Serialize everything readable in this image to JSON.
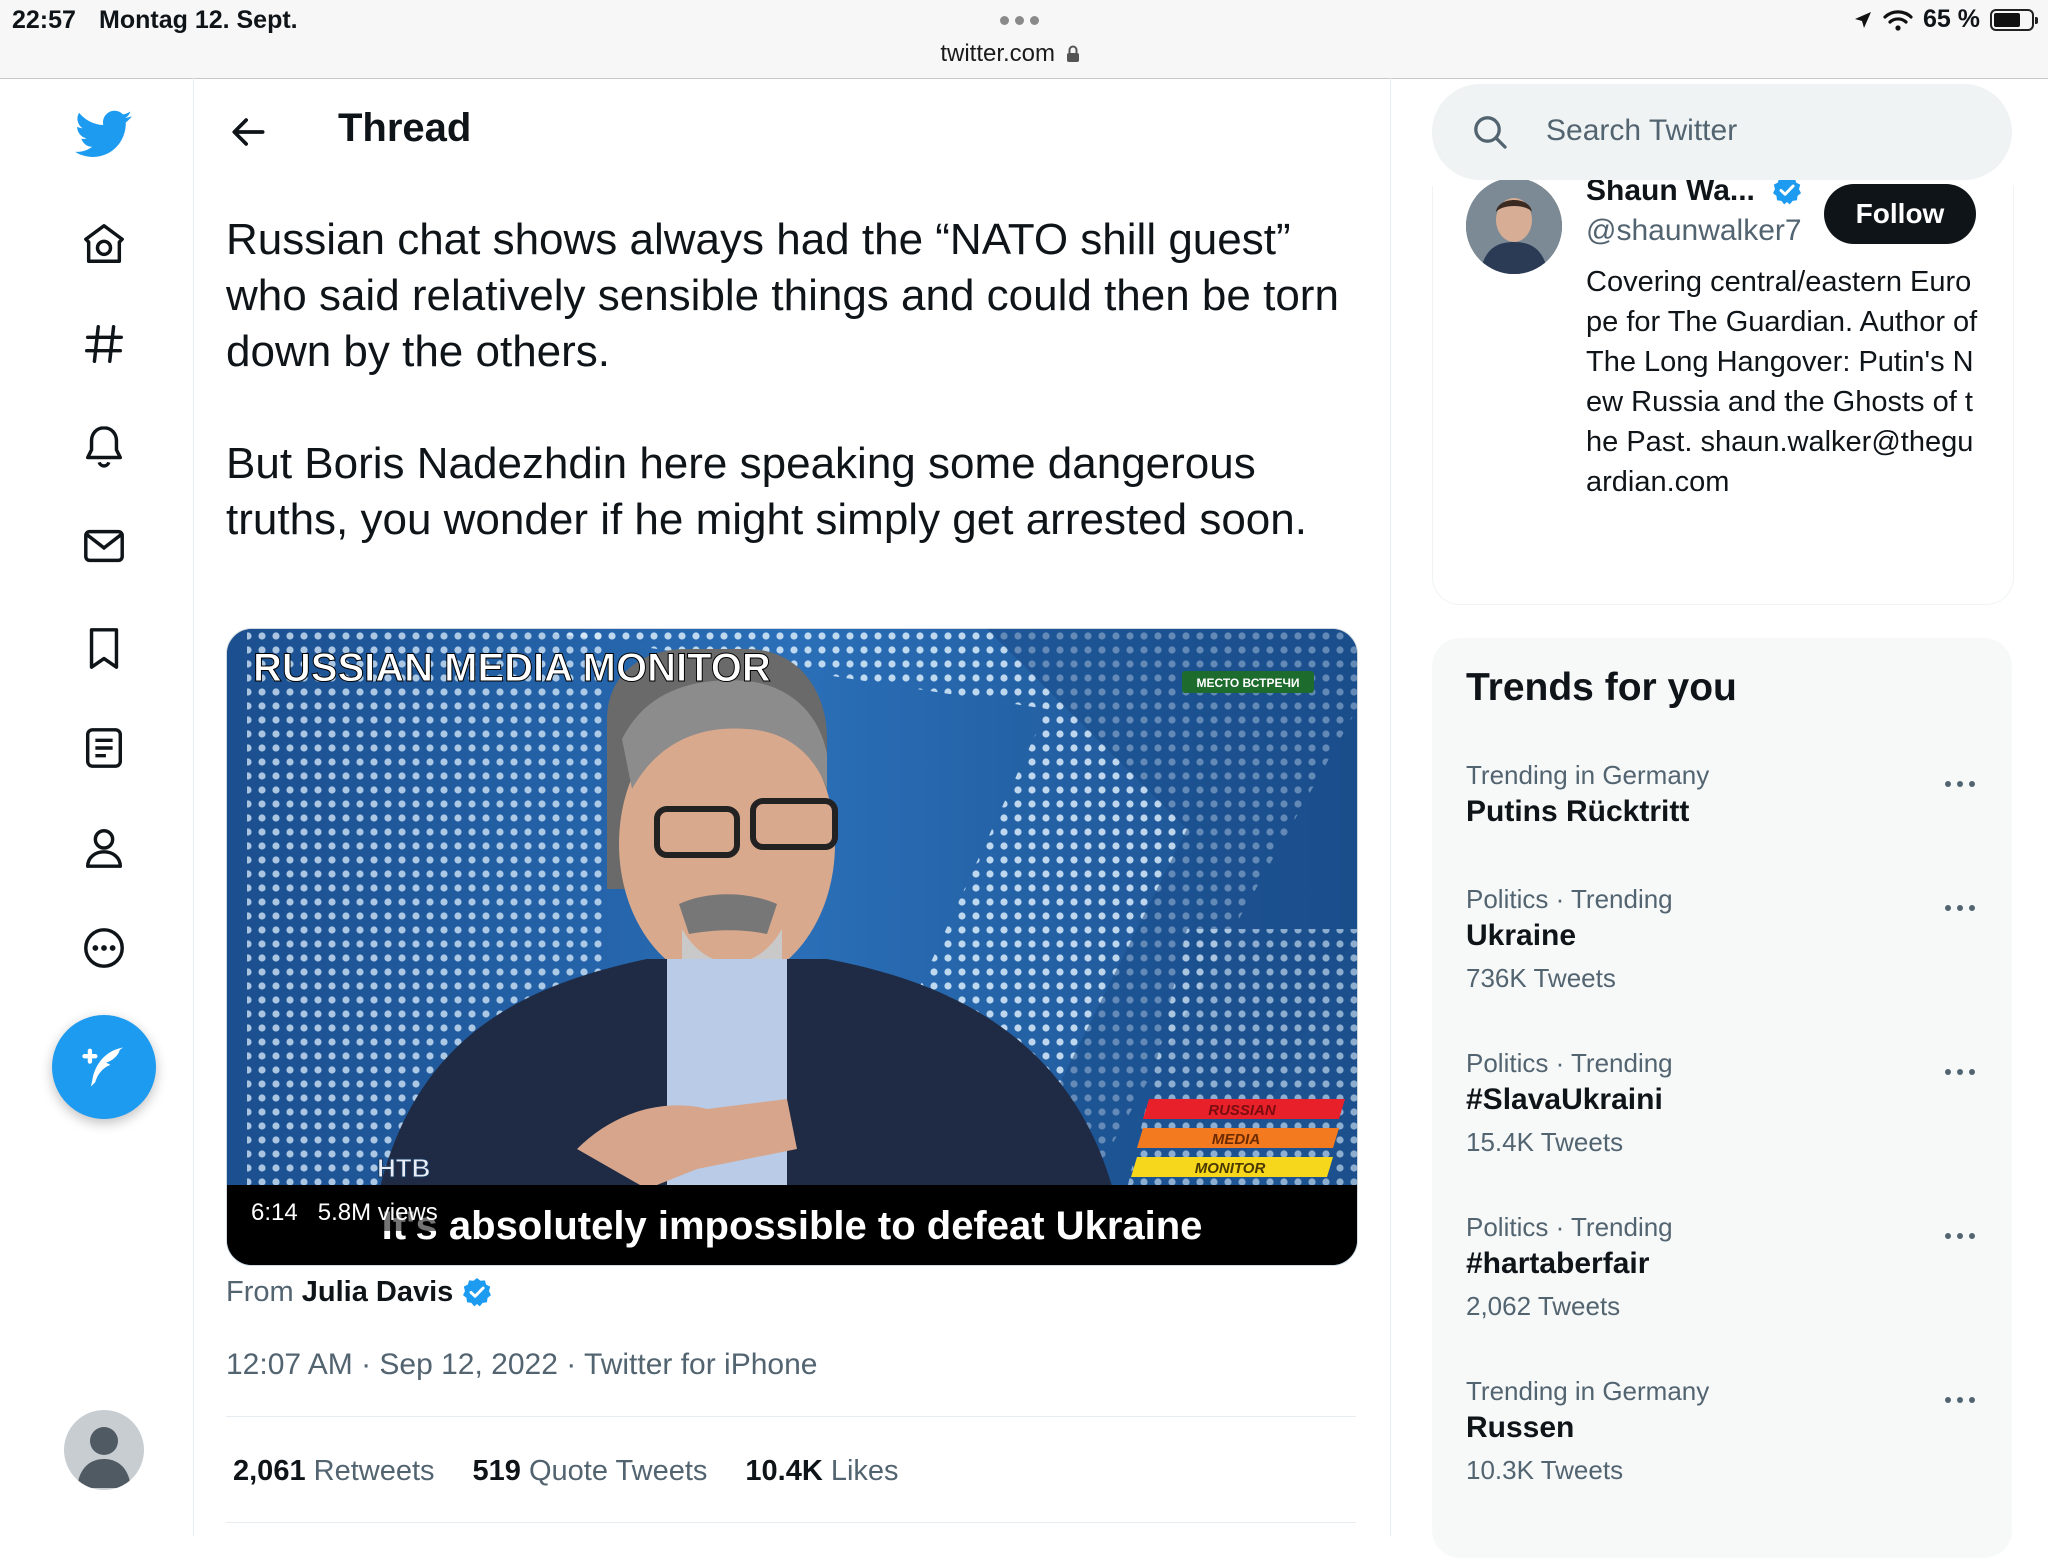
{
  "status_bar": {
    "time": "22:57",
    "date": "Montag 12. Sept.",
    "url": "twitter.com",
    "battery": "65 %"
  },
  "header": {
    "title": "Thread"
  },
  "tweet": {
    "paragraph1": "Russian chat shows always had the “NATO shill guest” who said relatively sensible things and could then be torn down by the others.",
    "paragraph2": "But Boris Nadezhdin here speaking some dangerous truths, you wonder if he might simply get arrested soon.",
    "media": {
      "overlay_title": "RUSSIAN MEDIA MONITOR",
      "channel_badge": "МЕСТО ВСТРЕЧИ",
      "badge_lines": [
        "RUSSIAN",
        "MEDIA",
        "MONITOR"
      ],
      "network_logo": "НТВ",
      "duration": "6:14",
      "views": "5.8M views",
      "subtitle": "It's absolutely impossible to defeat Ukraine"
    },
    "from_label": "From",
    "from_user": "Julia Davis",
    "timestamp": "12:07 AM · Sep 12, 2022 · Twitter for iPhone",
    "stats": {
      "retweets_count": "2,061",
      "retweets_label": "Retweets",
      "quotes_count": "519",
      "quotes_label": "Quote Tweets",
      "likes_count": "10.4K",
      "likes_label": "Likes"
    }
  },
  "search": {
    "placeholder": "Search Twitter"
  },
  "profile": {
    "name": "Shaun Wa...",
    "handle": "@shaunwalker7",
    "follow_label": "Follow",
    "bio": "Covering central/eastern Europe for The Guardian. Author of The Long Hangover: Putin's New Russia and the Ghosts of the Past. shaun.walker@theguardian.com"
  },
  "trends": {
    "title": "Trends for you",
    "items": [
      {
        "context": "Trending in Germany",
        "name": "Putins Rücktritt",
        "count": ""
      },
      {
        "context": "Politics · Trending",
        "name": "Ukraine",
        "count": "736K Tweets"
      },
      {
        "context": "Politics · Trending",
        "name": "#SlavaUkraini",
        "count": "15.4K Tweets"
      },
      {
        "context": "Politics · Trending",
        "name": "#hartaberfair",
        "count": "2,062 Tweets"
      },
      {
        "context": "Trending in Germany",
        "name": "Russen",
        "count": "10.3K Tweets"
      }
    ]
  },
  "colors": {
    "accent": "#1d9bf0",
    "text": "#0f1419",
    "muted": "#536471"
  },
  "icons": {
    "nav": [
      "twitter-logo-icon",
      "home-icon",
      "explore-hashtag-icon",
      "notifications-bell-icon",
      "messages-envelope-icon",
      "bookmarks-icon",
      "lists-icon",
      "profile-icon",
      "more-icon"
    ],
    "compose": "compose-tweet-icon"
  }
}
